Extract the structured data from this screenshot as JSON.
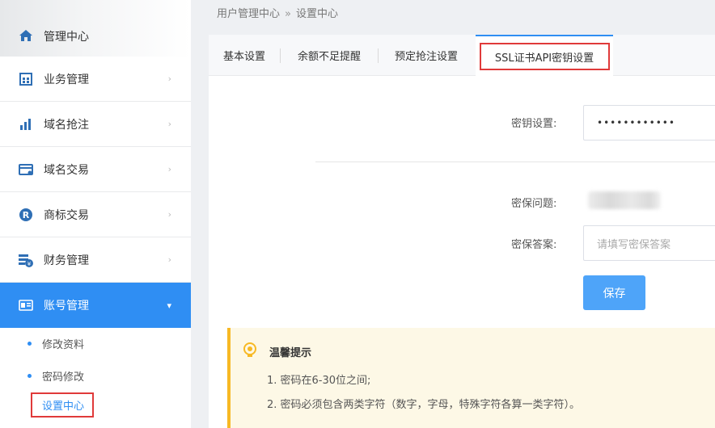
{
  "breadcrumb": {
    "root": "用户管理中心",
    "sep": "»",
    "current": "设置中心"
  },
  "sidebar": {
    "header_label": "管理中心",
    "items": [
      {
        "label": "业务管理",
        "icon": "grid-icon"
      },
      {
        "label": "域名抢注",
        "icon": "bar-chart-icon"
      },
      {
        "label": "域名交易",
        "icon": "card-icon"
      },
      {
        "label": "商标交易",
        "icon": "r-mark-icon"
      },
      {
        "label": "财务管理",
        "icon": "finance-icon"
      },
      {
        "label": "账号管理",
        "icon": "id-card-icon"
      }
    ],
    "sub_items": [
      {
        "label": "修改资料"
      },
      {
        "label": "密码修改"
      },
      {
        "label": "设置中心"
      }
    ],
    "accent": "#2f8ef3"
  },
  "tabs": [
    {
      "label": "基本设置"
    },
    {
      "label": "余额不足提醒"
    },
    {
      "label": "预定抢注设置"
    },
    {
      "label": "SSL证书API密钥设置"
    }
  ],
  "form": {
    "key_label": "密钥设置:",
    "key_value": "••••••••••••",
    "question_label": "密保问题:",
    "answer_label": "密保答案:",
    "answer_placeholder": "请填写密保答案",
    "save_label": "保存"
  },
  "tip": {
    "title": "温馨提示",
    "line1": "1. 密码在6-30位之间;",
    "line2": "2. 密码必须包含两类字符（数字，字母，特殊字符各算一类字符）。"
  }
}
